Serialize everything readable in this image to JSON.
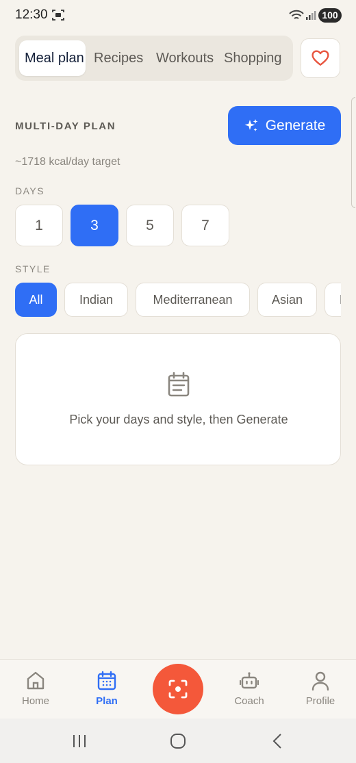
{
  "status_bar": {
    "time": "12:30",
    "battery": "100"
  },
  "tabs": [
    {
      "label": "Meal plan",
      "active": true
    },
    {
      "label": "Recipes",
      "active": false
    },
    {
      "label": "Workouts",
      "active": false
    },
    {
      "label": "Shopping",
      "active": false
    }
  ],
  "favorites_icon": "heart-icon",
  "plan": {
    "section_title": "MULTI-DAY PLAN",
    "generate_label": "Generate",
    "kcal_target": "~1718 kcal/day target",
    "days_label": "DAYS",
    "days": [
      {
        "label": "1",
        "active": false
      },
      {
        "label": "3",
        "active": true
      },
      {
        "label": "5",
        "active": false
      },
      {
        "label": "7",
        "active": false
      }
    ],
    "style_label": "STYLE",
    "styles": [
      {
        "label": "All",
        "active": true
      },
      {
        "label": "Indian",
        "active": false
      },
      {
        "label": "Mediterranean",
        "active": false
      },
      {
        "label": "Asian",
        "active": false
      },
      {
        "label": "H",
        "active": false
      }
    ],
    "empty_state_text": "Pick your days and style, then Generate"
  },
  "bottom_nav": {
    "items": [
      {
        "label": "Home",
        "icon": "home-icon",
        "active": false
      },
      {
        "label": "Plan",
        "icon": "calendar-icon",
        "active": true
      },
      {
        "label": "Coach",
        "icon": "robot-icon",
        "active": false
      },
      {
        "label": "Profile",
        "icon": "person-icon",
        "active": false
      }
    ],
    "center_icon": "scan-icon"
  },
  "colors": {
    "background": "#f6f3ed",
    "accent": "#2f6ef5",
    "scan": "#f4583a",
    "heart": "#e8553f"
  }
}
